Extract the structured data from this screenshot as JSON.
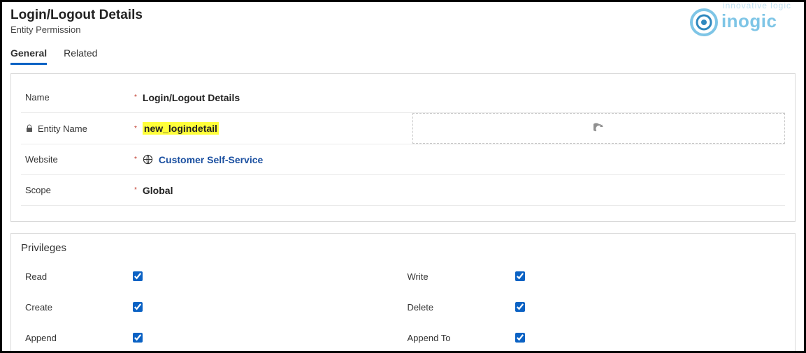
{
  "header": {
    "title": "Login/Logout Details",
    "subtitle": "Entity Permission"
  },
  "brand": {
    "tagline": "innovative logic",
    "name": "inogic"
  },
  "tabs": {
    "general": "General",
    "related": "Related"
  },
  "fields": {
    "name_label": "Name",
    "name_value": "Login/Logout Details",
    "entity_label": "Entity Name",
    "entity_value": "new_logindetail",
    "website_label": "Website",
    "website_value": "Customer Self-Service",
    "scope_label": "Scope",
    "scope_value": "Global"
  },
  "privileges": {
    "title": "Privileges",
    "read": "Read",
    "write": "Write",
    "create": "Create",
    "delete": "Delete",
    "append": "Append",
    "append_to": "Append To"
  }
}
